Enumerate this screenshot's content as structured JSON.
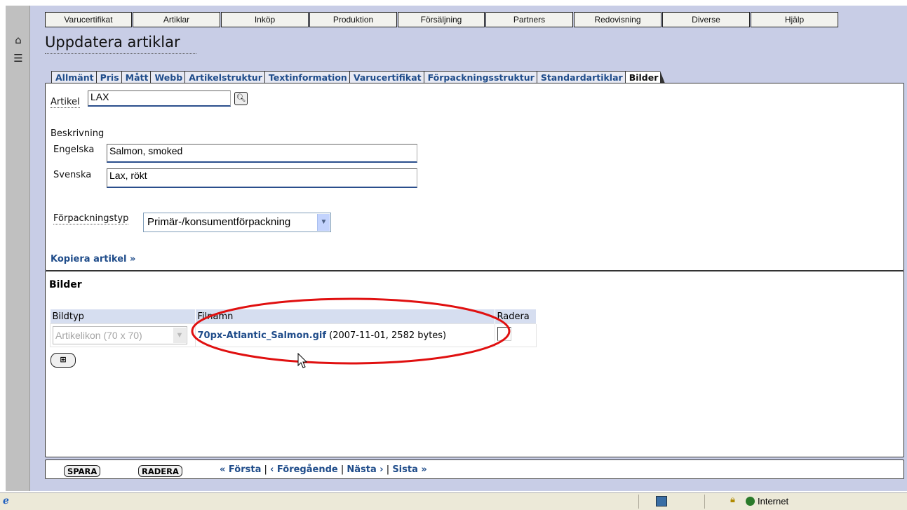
{
  "menu": [
    "Varucertifikat",
    "Artiklar",
    "Inköp",
    "Produktion",
    "Försäljning",
    "Partners",
    "Redovisning",
    "Diverse",
    "Hjälp"
  ],
  "page_title": "Uppdatera artiklar",
  "tabs": [
    "Allmänt",
    "Pris",
    "Mått",
    "Webb",
    "Artikelstruktur",
    "Textinformation",
    "Varucertifikat",
    "Förpackningsstruktur",
    "Standardartiklar",
    "Bilder"
  ],
  "active_tab": "Bilder",
  "artikel": {
    "label": "Artikel",
    "value": "LAX"
  },
  "beskrivning": {
    "heading": "Beskrivning",
    "english_label": "Engelska",
    "english_value": "Salmon, smoked",
    "swedish_label": "Svenska",
    "swedish_value": "Lax, rökt"
  },
  "forpackning": {
    "label": "Förpackningstyp",
    "selected": "Primär-/konsumentförpackning"
  },
  "copy_link": "Kopiera artikel »",
  "bilder": {
    "heading": "Bilder",
    "columns": [
      "Bildtyp",
      "Filnamn",
      "Radera"
    ],
    "rows": [
      {
        "bildtyp": "Artikelikon (70 x 70)",
        "filename": "70px-Atlantic_Salmon.gif",
        "meta": "(2007-11-01, 2582 bytes)"
      }
    ]
  },
  "footer": {
    "save": "SPARA",
    "delete": "RADERA",
    "first": "« Första",
    "prev": "‹ Föregående",
    "next": "Nästa ›",
    "last": "Sista »",
    "sep": "|"
  },
  "statusbar": {
    "zone": "Internet"
  },
  "colors": {
    "link": "#1f4c8a",
    "highlight_ellipse": "#e01010",
    "page_bg": "#c8cde6"
  }
}
